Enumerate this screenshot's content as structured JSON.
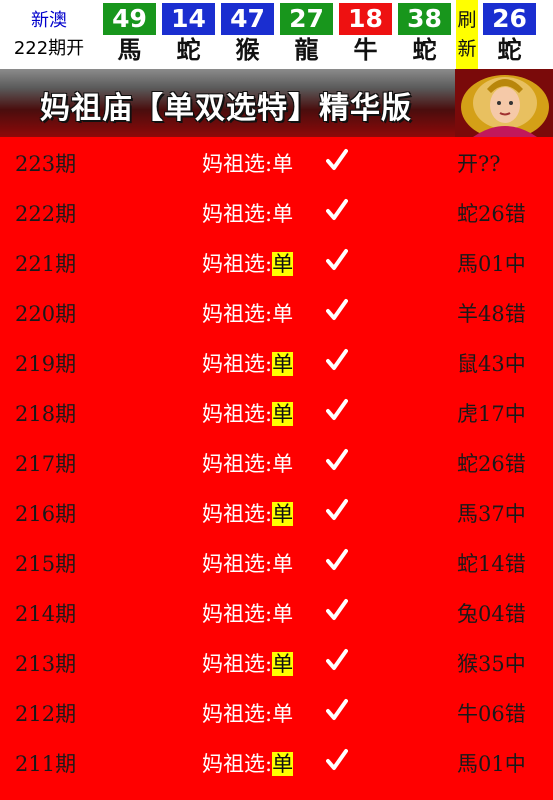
{
  "header": {
    "region": "新澳",
    "period": "222期开",
    "balls": [
      {
        "number": "49",
        "zodiac": "馬",
        "color": "green"
      },
      {
        "number": "14",
        "zodiac": "蛇",
        "color": "blue"
      },
      {
        "number": "47",
        "zodiac": "猴",
        "color": "blue"
      },
      {
        "number": "27",
        "zodiac": "龍",
        "color": "green"
      },
      {
        "number": "18",
        "zodiac": "牛",
        "color": "red"
      },
      {
        "number": "38",
        "zodiac": "蛇",
        "color": "green"
      }
    ],
    "refresh": [
      "刷",
      "新"
    ],
    "special": {
      "number": "26",
      "zodiac": "蛇",
      "color": "blue"
    }
  },
  "banner": {
    "title": "妈祖庙【单双选特】精华版"
  },
  "colors": {
    "background": "#ff0000",
    "highlight": "#ffff00",
    "green": "#18961c",
    "blue": "#1a2ed0",
    "red": "#ee1111"
  },
  "pick_label": "妈祖选:",
  "rows": [
    {
      "period": "223期",
      "pick": "单",
      "hit": false,
      "result": "开??"
    },
    {
      "period": "222期",
      "pick": "单",
      "hit": false,
      "result": "蛇26错"
    },
    {
      "period": "221期",
      "pick": "单",
      "hit": true,
      "result": "馬01中"
    },
    {
      "period": "220期",
      "pick": "单",
      "hit": false,
      "result": "羊48错"
    },
    {
      "period": "219期",
      "pick": "单",
      "hit": true,
      "result": "鼠43中"
    },
    {
      "period": "218期",
      "pick": "单",
      "hit": true,
      "result": "虎17中"
    },
    {
      "period": "217期",
      "pick": "单",
      "hit": false,
      "result": "蛇26错"
    },
    {
      "period": "216期",
      "pick": "单",
      "hit": true,
      "result": "馬37中"
    },
    {
      "period": "215期",
      "pick": "单",
      "hit": false,
      "result": "蛇14错"
    },
    {
      "period": "214期",
      "pick": "单",
      "hit": false,
      "result": "兔04错"
    },
    {
      "period": "213期",
      "pick": "单",
      "hit": true,
      "result": "猴35中"
    },
    {
      "period": "212期",
      "pick": "单",
      "hit": false,
      "result": "牛06错"
    },
    {
      "period": "211期",
      "pick": "单",
      "hit": true,
      "result": "馬01中"
    }
  ]
}
